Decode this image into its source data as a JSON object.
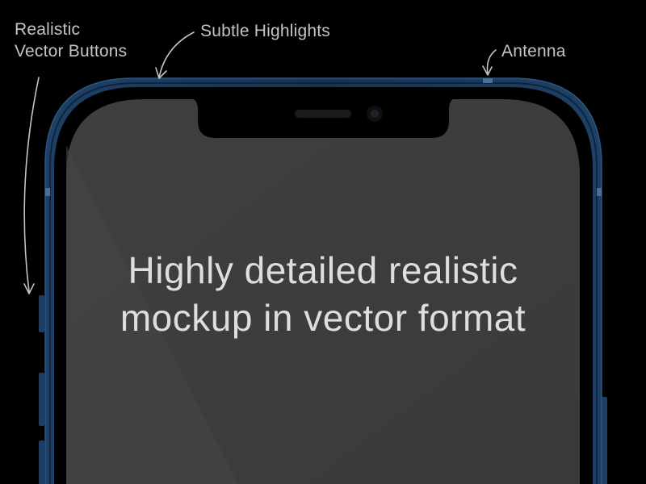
{
  "annotations": {
    "buttons_line1": "Realistic",
    "buttons_line2": "Vector Buttons",
    "highlights": "Subtle Highlights",
    "antenna": "Antenna"
  },
  "screen": {
    "headline_line1": "Highly detailed realistic",
    "headline_line2": "mockup in vector format"
  },
  "colors": {
    "background": "#000000",
    "frame": "#1b3a5c",
    "frame_highlight": "#2f5a85",
    "screen": "#3d3d3d",
    "notch": "#000000",
    "annotation_text": "#c4c4c4",
    "headline_text": "#dedede"
  }
}
